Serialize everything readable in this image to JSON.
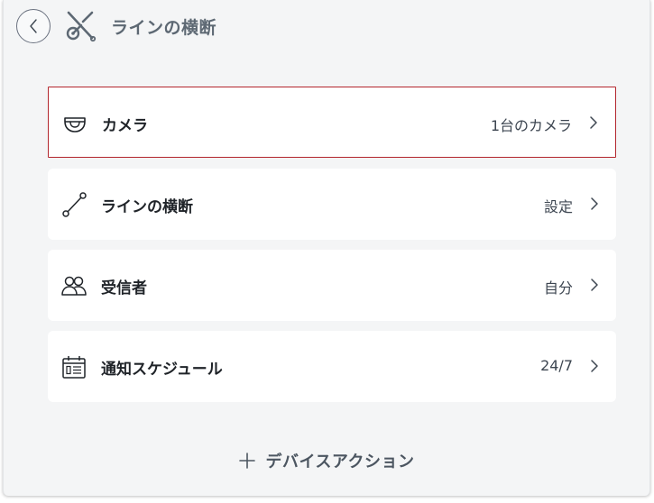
{
  "header": {
    "title": "ラインの横断",
    "back_icon": "chevron-left-icon",
    "feature_icon": "line-crossing-icon"
  },
  "settings": [
    {
      "label": "カメラ",
      "value": "1台のカメラ",
      "icon": "camera-dome-icon",
      "selected": true
    },
    {
      "label": "ラインの横断",
      "value": "設定",
      "icon": "line-icon",
      "selected": false
    },
    {
      "label": "受信者",
      "value": "自分",
      "icon": "users-icon",
      "selected": false
    },
    {
      "label": "通知スケジュール",
      "value": "24/7",
      "icon": "calendar-icon",
      "selected": false
    }
  ],
  "footer": {
    "device_actions_label": "デバイスアクション"
  },
  "colors": {
    "selected_border": "#b3262d",
    "panel_background": "#f4f5f6",
    "card_background": "#ffffff",
    "title_color": "#5d6873"
  }
}
